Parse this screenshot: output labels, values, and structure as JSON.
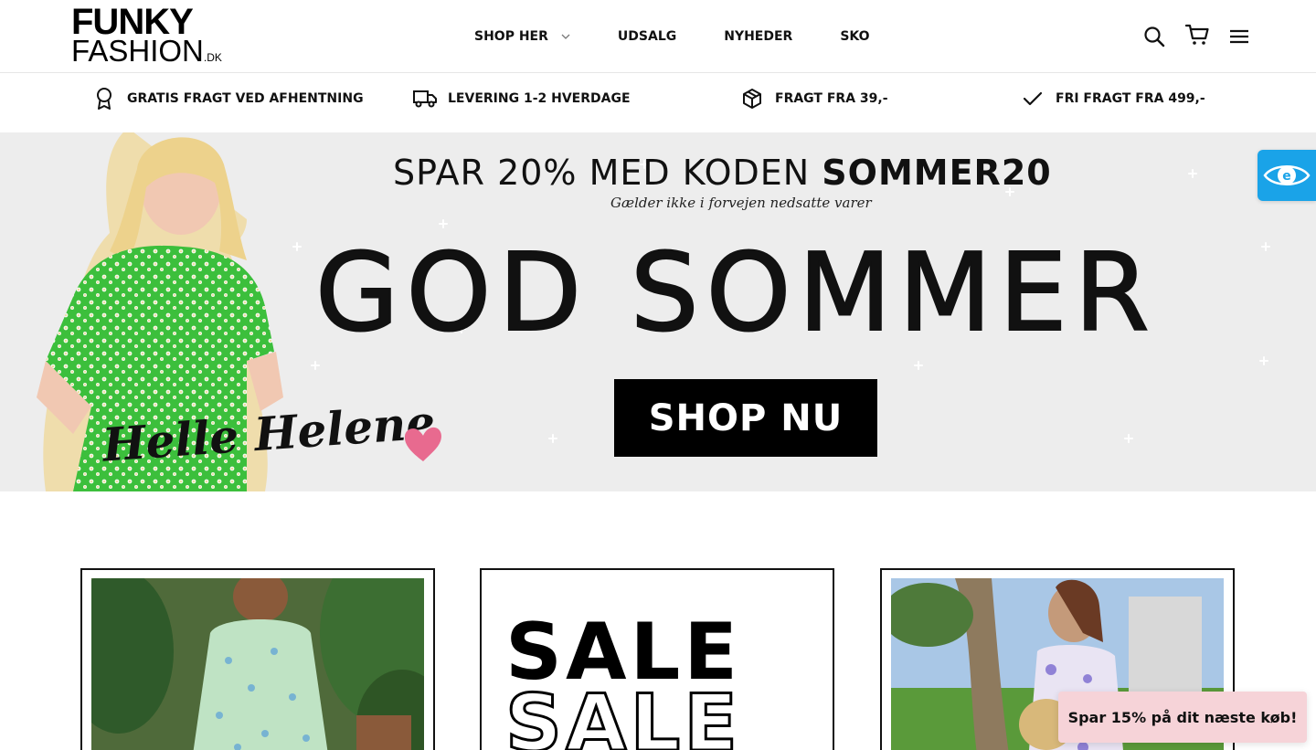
{
  "brand": {
    "logo_top": "FUNKY",
    "logo_bottom": "FASHION",
    "logo_suffix": ".DK"
  },
  "nav": {
    "items": [
      {
        "label": "SHOP HER",
        "has_dropdown": true
      },
      {
        "label": "UDSALG"
      },
      {
        "label": "NYHEDER"
      },
      {
        "label": "SKO"
      }
    ]
  },
  "header_icons": [
    "search-icon",
    "cart-icon",
    "menu-icon"
  ],
  "usps": [
    {
      "icon": "award-icon",
      "label": "GRATIS FRAGT VED AFHENTNING"
    },
    {
      "icon": "truck-icon",
      "label": "LEVERING 1-2 HVERDAGE"
    },
    {
      "icon": "package-icon",
      "label": "FRAGT FRA 39,-"
    },
    {
      "icon": "check-icon",
      "label": "FRI FRAGT FRA 499,-"
    }
  ],
  "hero": {
    "promo_prefix": "SPAR 20% MED KODEN ",
    "promo_code": "SOMMER20",
    "promo_note": "Gælder ikke i forvejen nedsatte varer",
    "headline": "GOD SOMMER",
    "cta": "SHOP NU",
    "signature": "Helle Helene",
    "background": "#ededed",
    "dress_color": "#3cbf3c",
    "heart_color": "#e86a8f"
  },
  "cards": {
    "sale_word": "SALE"
  },
  "accessibility_widget": {
    "icon": "eye-icon",
    "color": "#1aa3e8"
  },
  "discount_popup": {
    "label": "Spar 15% på dit næste køb!",
    "color": "#f6d3d8"
  }
}
